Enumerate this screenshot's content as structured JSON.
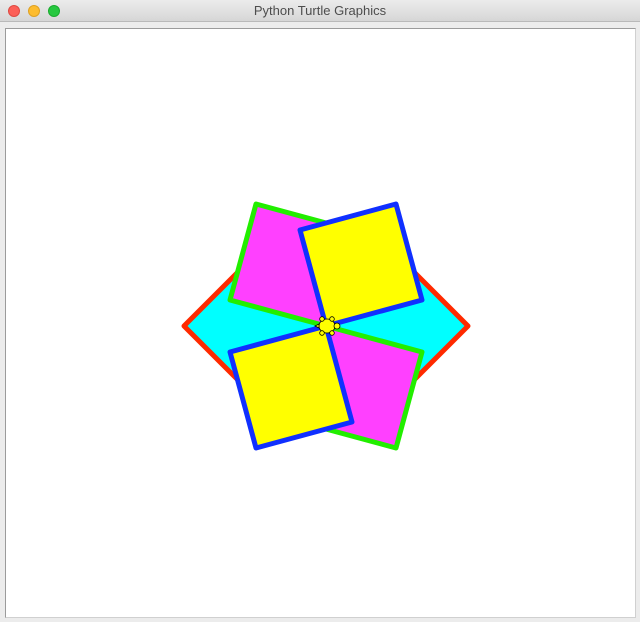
{
  "window": {
    "title": "Python Turtle Graphics"
  },
  "drawing": {
    "squares": [
      {
        "name": "cyan-square",
        "fill": "#00ffff",
        "stroke": "#ff2a00"
      },
      {
        "name": "magenta-square",
        "fill": "#ff40ff",
        "stroke": "#22ee00"
      },
      {
        "name": "yellow-square",
        "fill": "#ffff00",
        "stroke": "#1030ff"
      }
    ],
    "turtle": {
      "icon": "turtle-icon",
      "fill": "#ffff00",
      "stroke": "#000000"
    }
  }
}
